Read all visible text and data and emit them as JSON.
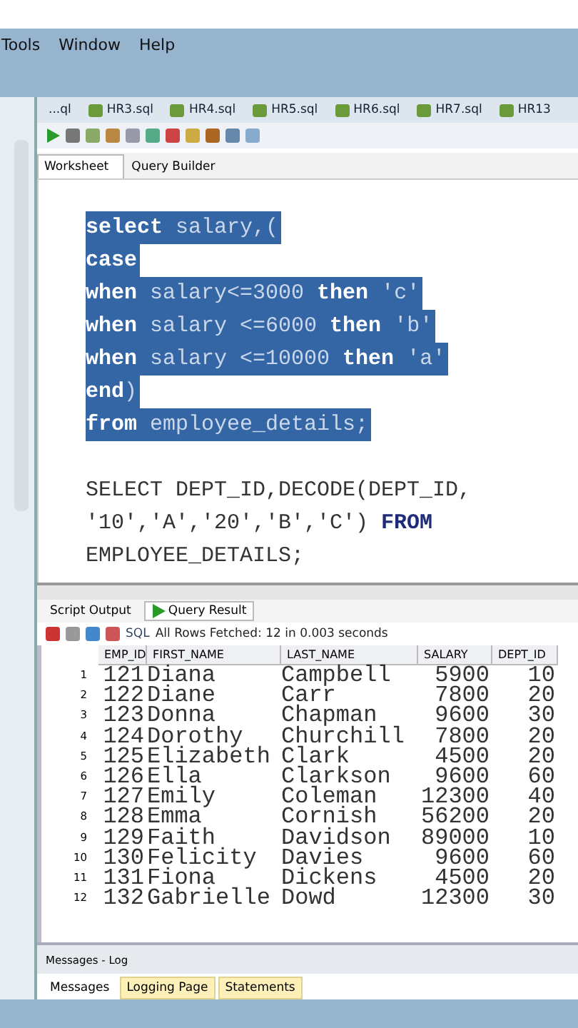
{
  "menu": [
    "Tools",
    "Window",
    "Help"
  ],
  "file_tabs": [
    {
      "label": "...ql",
      "icon": false
    },
    {
      "label": "HR3.sql",
      "icon": true
    },
    {
      "label": "HR4.sql",
      "icon": true
    },
    {
      "label": "HR5.sql",
      "icon": true
    },
    {
      "label": "HR6.sql",
      "icon": true
    },
    {
      "label": "HR7.sql",
      "icon": true
    },
    {
      "label": "HR13",
      "icon": true
    }
  ],
  "editor_tabs": [
    {
      "label": "Worksheet",
      "selected": true
    },
    {
      "label": "Query Builder",
      "selected": false
    }
  ],
  "code_blocks": [
    {
      "lines": [
        {
          "text": "**select** salary,(",
          "selected": true
        },
        {
          "text": "**case**",
          "selected": true
        },
        {
          "text": "**when** salary<=3000 **then** 'c'",
          "selected": true
        },
        {
          "text": "**when** salary <=6000 **then** 'b'",
          "selected": true
        },
        {
          "text": "**when** salary <=10000 **then** 'a'",
          "selected": true
        },
        {
          "text": "**end**)",
          "selected": true
        },
        {
          "text": "**from** employee_details;",
          "selected": true
        }
      ]
    },
    {
      "lines": [
        {
          "text": "SELECT DEPT_ID,DECODE(DEPT_ID,",
          "selected": false
        },
        {
          "text": "'10','A','20','B','C') **FROM**",
          "selected": false
        },
        {
          "text": "EMPLOYEE_DETAILS;",
          "selected": false
        }
      ]
    }
  ],
  "result_tabs": [
    {
      "label": "Script Output",
      "selected": false
    },
    {
      "label": "Query Result",
      "selected": true
    }
  ],
  "result_toolbar": {
    "sql": "SQL",
    "status": "All Rows Fetched: 12 in 0.003 seconds"
  },
  "table": {
    "columns": [
      "",
      "EMP_ID",
      "FIRST_NAME",
      "LAST_NAME",
      "SALARY",
      "DEPT_ID"
    ],
    "rows": [
      [
        "1",
        "121",
        "Diana",
        "Campbell",
        "5900",
        "10"
      ],
      [
        "2",
        "122",
        "Diane",
        "Carr",
        "7800",
        "20"
      ],
      [
        "3",
        "123",
        "Donna",
        "Chapman",
        "9600",
        "30"
      ],
      [
        "4",
        "124",
        "Dorothy",
        "Churchill",
        "7800",
        "20"
      ],
      [
        "5",
        "125",
        "Elizabeth",
        "Clark",
        "4500",
        "20"
      ],
      [
        "6",
        "126",
        "Ella",
        "Clarkson",
        "9600",
        "60"
      ],
      [
        "7",
        "127",
        "Emily",
        "Coleman",
        "12300",
        "40"
      ],
      [
        "8",
        "128",
        "Emma",
        "Cornish",
        "56200",
        "20"
      ],
      [
        "9",
        "129",
        "Faith",
        "Davidson",
        "89000",
        "10"
      ],
      [
        "10",
        "130",
        "Felicity",
        "Davies",
        "9600",
        "60"
      ],
      [
        "11",
        "131",
        "Fiona",
        "Dickens",
        "4500",
        "20"
      ],
      [
        "12",
        "132",
        "Gabrielle",
        "Dowd",
        "12300",
        "30"
      ]
    ]
  },
  "messages": {
    "title": "Messages - Log",
    "tabs": [
      {
        "label": "Messages",
        "selected": true
      },
      {
        "label": "Logging Page",
        "selected": false
      },
      {
        "label": "Statements",
        "selected": false
      }
    ]
  }
}
